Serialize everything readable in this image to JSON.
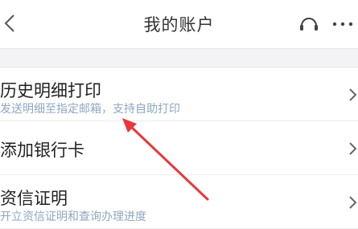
{
  "header": {
    "title": "我的账户",
    "back_icon": "chevron-left-icon",
    "service_icon": "headset-icon",
    "more_icon": "more-dots-icon"
  },
  "menu": {
    "items": [
      {
        "label": "历史明细打印",
        "subtitle": "发送明细至指定邮箱，支持自助打印"
      },
      {
        "label": "添加银行卡",
        "subtitle": ""
      },
      {
        "label": "资信证明",
        "subtitle": "开立资信证明和查询办理进度"
      }
    ]
  },
  "colors": {
    "title": "#333333",
    "subtitle": "#8fa7bf",
    "annotation": "#e8383d",
    "separator_band": "#f3f3f5"
  }
}
